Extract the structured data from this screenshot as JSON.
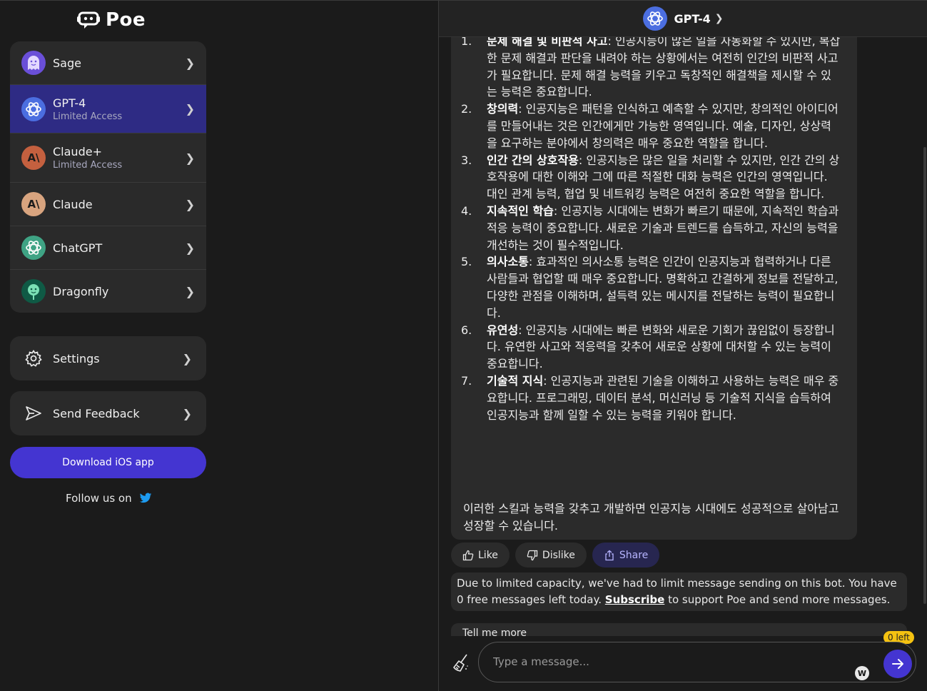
{
  "app": {
    "logo_text": "Poe"
  },
  "sidebar": {
    "bots": [
      {
        "name": "Sage",
        "sub": ""
      },
      {
        "name": "GPT-4",
        "sub": "Limited Access"
      },
      {
        "name": "Claude+",
        "sub": "Limited Access"
      },
      {
        "name": "Claude",
        "sub": ""
      },
      {
        "name": "ChatGPT",
        "sub": ""
      },
      {
        "name": "Dragonfly",
        "sub": ""
      }
    ],
    "settings_label": "Settings",
    "feedback_label": "Send Feedback",
    "download_label": "Download iOS app",
    "follow_label": "Follow us on"
  },
  "chat": {
    "title": "GPT-4",
    "items": [
      {
        "num": "1.",
        "bold": "문제 해결 및 비판적 사고",
        "text": ": 인공지능이 많은 일을 자동화할 수 있지만, 복잡한 문제 해결과 판단을 내려야 하는 상황에서는 여전히 인간의 비판적 사고가 필요합니다. 문제 해결 능력을 키우고 독창적인 해결책을 제시할 수 있는 능력은 중요합니다."
      },
      {
        "num": "2.",
        "bold": "창의력",
        "text": ": 인공지능은 패턴을 인식하고 예측할 수 있지만, 창의적인 아이디어를 만들어내는 것은 인간에게만 가능한 영역입니다. 예술, 디자인, 상상력을 요구하는 분야에서 창의력은 매우 중요한 역할을 합니다."
      },
      {
        "num": "3.",
        "bold": "인간 간의 상호작용",
        "text": ": 인공지능은 많은 일을 처리할 수 있지만, 인간 간의 상호작용에 대한 이해와 그에 따른 적절한 대화 능력은 인간의 영역입니다. 대인 관계 능력, 협업 및 네트워킹 능력은 여전히 중요한 역할을 합니다."
      },
      {
        "num": "4.",
        "bold": "지속적인 학습",
        "text": ": 인공지능 시대에는 변화가 빠르기 때문에, 지속적인 학습과 적응 능력이 중요합니다. 새로운 기술과 트렌드를 습득하고, 자신의 능력을 개선하는 것이 필수적입니다."
      },
      {
        "num": "5.",
        "bold": "의사소통",
        "text": ": 효과적인 의사소통 능력은 인간이 인공지능과 협력하거나 다른 사람들과 협업할 때 매우 중요합니다. 명확하고 간결하게 정보를 전달하고, 다양한 관점을 이해하며, 설득력 있는 메시지를 전달하는 능력이 필요합니다."
      },
      {
        "num": "6.",
        "bold": "유연성",
        "text": ": 인공지능 시대에는 빠른 변화와 새로운 기회가 끊임없이 등장합니다. 유연한 사고와 적응력을 갖추어 새로운 상황에 대처할 수 있는 능력이 중요합니다."
      },
      {
        "num": "7.",
        "bold": "기술적 지식",
        "text": ": 인공지능과 관련된 기술을 이해하고 사용하는 능력은 매우 중요합니다. 프로그래밍, 데이터 분석, 머신러닝 등 기술적 지식을 습득하여 인공지능과 함께 일할 수 있는 능력을 키워야 합니다."
      }
    ],
    "conclusion": "이러한 스킬과 능력을 갖추고 개발하면 인공지능 시대에도 성공적으로 살아남고 성장할 수 있습니다.",
    "like_label": "Like",
    "dislike_label": "Dislike",
    "share_label": "Share",
    "limit_text_1": "Due to limited capacity, we've had to limit message sending on this bot. You have 0 free messages left today.",
    "subscribe_label": "Subscribe",
    "limit_text_2": "to support Poe and send more messages.",
    "suggestion": "Tell me more",
    "left_badge": "0 left",
    "input_placeholder": "Type a message...",
    "w_label": "W"
  },
  "colors": {
    "accent": "#4435d1",
    "selected": "#2e2b84",
    "badge": "#f5c211",
    "twitter": "#1d9bf0"
  }
}
